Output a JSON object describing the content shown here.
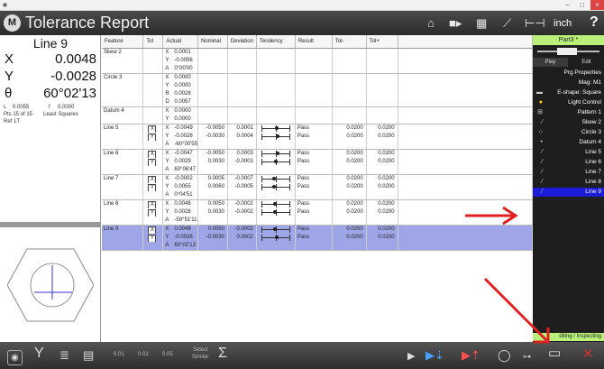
{
  "window": {
    "title": "Tolerance Report",
    "logo_letter": "M",
    "unit_label": "inch",
    "help_label": "?"
  },
  "feature_readout": {
    "name": "Line 9",
    "rows": [
      {
        "label": "X",
        "value": "0.0048"
      },
      {
        "label": "Y",
        "value": "-0.0028"
      },
      {
        "label": "θ",
        "value": "60°02'13"
      }
    ],
    "l_label": "L",
    "l_value": "0.0055",
    "f_label": "f",
    "f_value": "0.0000",
    "pts": "Pts 15 of 15",
    "method": "Least Squares",
    "ref": "Ref 1T"
  },
  "table": {
    "headers": [
      "Feature",
      "Tol",
      "Actual",
      "Nominal",
      "Deviation",
      "Tendency",
      "Result",
      "Tol-",
      "Tol+"
    ],
    "rows": [
      {
        "feature": "Skew 2",
        "lines": [
          {
            "tol": "",
            "axis": "X",
            "actual": "0.0001",
            "nominal": "",
            "deviation": "",
            "tend": null,
            "result": "",
            "tolm": "",
            "tolp": ""
          },
          {
            "tol": "",
            "axis": "Y",
            "actual": "-0.0056",
            "nominal": "",
            "deviation": "",
            "tend": null,
            "result": "",
            "tolm": "",
            "tolp": ""
          },
          {
            "tol": "",
            "axis": "A",
            "actual": "0°00'00",
            "nominal": "",
            "deviation": "",
            "tend": null,
            "result": "",
            "tolm": "",
            "tolp": ""
          }
        ]
      },
      {
        "feature": "Circle 3",
        "lines": [
          {
            "tol": "",
            "axis": "X",
            "actual": "0.0000",
            "nominal": "",
            "deviation": "",
            "tend": null,
            "result": "",
            "tolm": "",
            "tolp": ""
          },
          {
            "tol": "",
            "axis": "Y",
            "actual": "0.0000",
            "nominal": "",
            "deviation": "",
            "tend": null,
            "result": "",
            "tolm": "",
            "tolp": ""
          },
          {
            "tol": "",
            "axis": "R",
            "actual": "0.0028",
            "nominal": "",
            "deviation": "",
            "tend": null,
            "result": "",
            "tolm": "",
            "tolp": ""
          },
          {
            "tol": "",
            "axis": "D",
            "actual": "0.0057",
            "nominal": "",
            "deviation": "",
            "tend": null,
            "result": "",
            "tolm": "",
            "tolp": ""
          }
        ]
      },
      {
        "feature": "Datum 4",
        "lines": [
          {
            "tol": "",
            "axis": "X",
            "actual": "0.0000",
            "nominal": "",
            "deviation": "",
            "tend": null,
            "result": "",
            "tolm": "",
            "tolp": ""
          },
          {
            "tol": "",
            "axis": "Y",
            "actual": "0.0000",
            "nominal": "",
            "deviation": "",
            "tend": null,
            "result": "",
            "tolm": "",
            "tolp": ""
          }
        ]
      },
      {
        "feature": "Line 5",
        "lines": [
          {
            "tol": "X",
            "axis": "X",
            "actual": "-0.0049",
            "nominal": "-0.0050",
            "deviation": "0.0001",
            "tend": 0.52,
            "result": "Pass",
            "tolm": "0.0200",
            "tolp": "0.0200"
          },
          {
            "tol": "Y",
            "axis": "Y",
            "actual": "-0.0026",
            "nominal": "-0.0030",
            "deviation": "0.0004",
            "tend": 0.56,
            "result": "Pass",
            "tolm": "0.0200",
            "tolp": "0.0200"
          },
          {
            "tol": "",
            "axis": "A",
            "actual": "-60°00'55",
            "nominal": "",
            "deviation": "",
            "tend": null,
            "result": "",
            "tolm": "",
            "tolp": ""
          }
        ]
      },
      {
        "feature": "Line 6",
        "lines": [
          {
            "tol": "X",
            "axis": "X",
            "actual": "-0.0047",
            "nominal": "-0.0050",
            "deviation": "0.0003",
            "tend": 0.55,
            "result": "Pass",
            "tolm": "0.0200",
            "tolp": "0.0200"
          },
          {
            "tol": "Y",
            "axis": "Y",
            "actual": "0.0029",
            "nominal": "0.0030",
            "deviation": "-0.0001",
            "tend": 0.48,
            "result": "Pass",
            "tolm": "0.0200",
            "tolp": "0.0200"
          },
          {
            "tol": "",
            "axis": "A",
            "actual": "60°06'47",
            "nominal": "",
            "deviation": "",
            "tend": null,
            "result": "",
            "tolm": "",
            "tolp": ""
          }
        ]
      },
      {
        "feature": "Line 7",
        "lines": [
          {
            "tol": "X",
            "axis": "X",
            "actual": "-0.0002",
            "nominal": "0.0005",
            "deviation": "-0.0007",
            "tend": 0.42,
            "result": "Pass",
            "tolm": "0.0200",
            "tolp": "0.0200"
          },
          {
            "tol": "Y",
            "axis": "Y",
            "actual": "0.0055",
            "nominal": "0.0060",
            "deviation": "-0.0005",
            "tend": 0.44,
            "result": "Pass",
            "tolm": "0.0200",
            "tolp": "0.0200"
          },
          {
            "tol": "",
            "axis": "A",
            "actual": "0°04'51",
            "nominal": "",
            "deviation": "",
            "tend": null,
            "result": "",
            "tolm": "",
            "tolp": ""
          }
        ]
      },
      {
        "feature": "Line 8",
        "lines": [
          {
            "tol": "X",
            "axis": "X",
            "actual": "0.0048",
            "nominal": "0.0050",
            "deviation": "-0.0002",
            "tend": 0.47,
            "result": "Pass",
            "tolm": "0.0200",
            "tolp": "0.0200"
          },
          {
            "tol": "Y",
            "axis": "Y",
            "actual": "0.0028",
            "nominal": "0.0030",
            "deviation": "-0.0002",
            "tend": 0.47,
            "result": "Pass",
            "tolm": "0.0200",
            "tolp": "0.0200"
          },
          {
            "tol": "",
            "axis": "A",
            "actual": "-59°51'11",
            "nominal": "",
            "deviation": "",
            "tend": null,
            "result": "",
            "tolm": "",
            "tolp": ""
          }
        ]
      },
      {
        "feature": "Line 9",
        "selected": true,
        "lines": [
          {
            "tol": "X",
            "axis": "X",
            "actual": "0.0048",
            "nominal": "0.0050",
            "deviation": "-0.0002",
            "tend": 0.47,
            "result": "Pass",
            "tolm": "0.0200",
            "tolp": "0.0200"
          },
          {
            "tol": "Y",
            "axis": "Y",
            "actual": "-0.0028",
            "nominal": "-0.0030",
            "deviation": "0.0002",
            "tend": 0.53,
            "result": "Pass",
            "tolm": "0.0200",
            "tolp": "0.0200"
          },
          {
            "tol": "",
            "axis": "A",
            "actual": "60°02'13",
            "nominal": "",
            "deviation": "",
            "tend": null,
            "result": "",
            "tolm": "",
            "tolp": ""
          }
        ]
      }
    ]
  },
  "right_panel": {
    "part": "Part3 *",
    "tabs": [
      "Play",
      "Edit"
    ],
    "items": [
      {
        "label": "Prg Properties",
        "icon": ""
      },
      {
        "label": "Mag: M1",
        "icon": ""
      },
      {
        "label": "E-shape: Square",
        "icon": "square-icon"
      },
      {
        "label": "Light Control",
        "icon": "bulb-icon"
      },
      {
        "label": "Pattern 1",
        "icon": "pattern-icon"
      },
      {
        "label": "Skew 2",
        "icon": "line-icon"
      },
      {
        "label": "Circle 3",
        "icon": "circle-icon"
      },
      {
        "label": "Datum 4",
        "icon": "dot-icon"
      },
      {
        "label": "Line 5",
        "icon": "line-icon"
      },
      {
        "label": "Line 6",
        "icon": "line-icon"
      },
      {
        "label": "Line 7",
        "icon": "line-icon"
      },
      {
        "label": "Line 8",
        "icon": "line-icon"
      },
      {
        "label": "Line 9",
        "icon": "line-icon",
        "selected": true
      }
    ],
    "status": "diting / Inspecting"
  },
  "bottom_bar": {
    "tol_presets": [
      "0.01",
      "0.02",
      "0.05"
    ],
    "select_similar": [
      "Select",
      "Similar"
    ],
    "sigma": "Σ"
  },
  "colors": {
    "accent_green": "#b9f07a",
    "selected_row": "#9fa6e8",
    "selected_item": "#1c1cd8",
    "arrow_red": "#e02020"
  }
}
